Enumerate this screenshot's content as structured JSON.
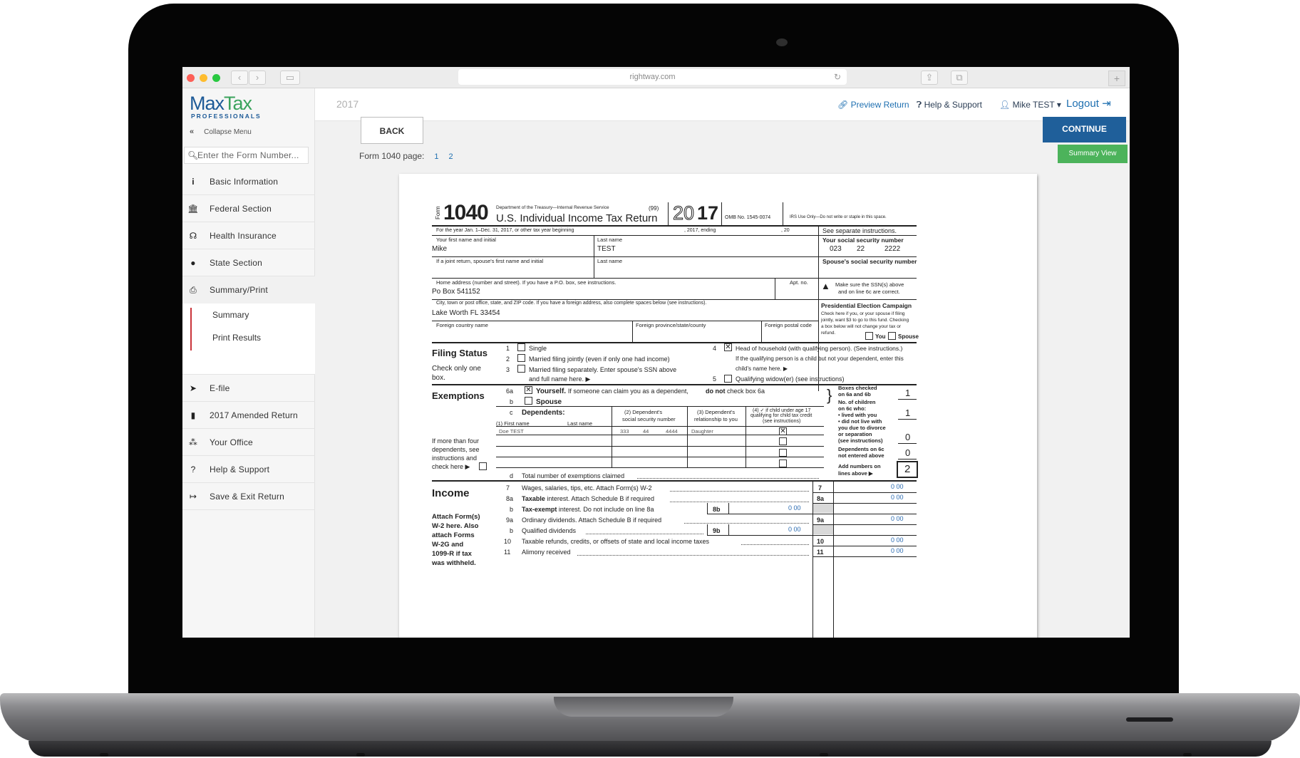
{
  "browser": {
    "url": "rightway.com"
  },
  "brand": {
    "logo_max": "Max",
    "logo_tax": "Tax",
    "logo_sub": "PROFESSIONALS",
    "colors": {
      "primary": "#1d5a97",
      "green": "#3aa35c",
      "accent_red": "#c9343a",
      "continue_blue": "#1f5f9a",
      "summary_green": "#4cb35b"
    }
  },
  "sidebar": {
    "collapse": "Collapse Menu",
    "search_placeholder": "Enter the Form Number...",
    "items": [
      {
        "label": "Basic Information",
        "icon": "info-icon"
      },
      {
        "label": "Federal Section",
        "icon": "bank-icon"
      },
      {
        "label": "Health Insurance",
        "icon": "stethoscope-icon"
      },
      {
        "label": "State Section",
        "icon": "map-pin-icon"
      },
      {
        "label": "Summary/Print",
        "icon": "printer-icon"
      },
      {
        "label": "E-file",
        "icon": "send-icon"
      },
      {
        "label": "2017 Amended Return",
        "icon": "document-icon"
      },
      {
        "label": "Your Office",
        "icon": "cubes-icon"
      },
      {
        "label": "Help & Support",
        "icon": "question-icon"
      },
      {
        "label": "Save & Exit Return",
        "icon": "sign-out-icon"
      }
    ],
    "sub_items": [
      "Summary",
      "Print Results"
    ]
  },
  "topbar": {
    "year": "2017",
    "preview": "Preview Return",
    "help": "Help & Support",
    "user": "Mike TEST ▾",
    "logout": "Logout"
  },
  "content": {
    "back": "BACK",
    "continue": "CONTINUE",
    "form_page_label": "Form 1040 page:",
    "pages": [
      "1",
      "2"
    ],
    "summary_view": "Summary View"
  },
  "form": {
    "form_word": "Form",
    "number": "1040",
    "dept": "Department of the Treasury—Internal Revenue Service",
    "code": "(99)",
    "title": "U.S. Individual Income Tax Return",
    "year_outline": "20",
    "year_bold": "17",
    "omb": "OMB No. 1545-0074",
    "irs_use": "IRS Use Only—Do not write or staple in this space.",
    "period": "For the year Jan. 1–Dec. 31, 2017, or other tax year beginning",
    "ending": ", 2017, ending",
    "twenty": ", 20",
    "see_sep": "See separate instructions.",
    "first_name_label": "Your first name and initial",
    "first_name": "Mike",
    "last_name_label": "Last name",
    "last_name": "TEST",
    "ssn_label": "Your social security number",
    "ssn": [
      "023",
      "22",
      "2222"
    ],
    "spouse_name_label": "If a joint return, spouse's first name and initial",
    "spouse_last_label": "Last name",
    "spouse_ssn_label": "Spouse's social security number",
    "address_label": "Home address (number and street). If you have a P.O. box, see instructions.",
    "address": "Po Box 541152",
    "apt_label": "Apt. no.",
    "ssn_note": [
      "Make sure the SSN(s) above",
      "and on line 6c are correct."
    ],
    "city_label": "City, town or post office, state, and ZIP code. If you have a foreign address, also complete spaces below (see instructions).",
    "city": "Lake Worth FL 33454",
    "pec_title": "Presidential Election Campaign",
    "pec_text": [
      "Check here if you, or your spouse if filing",
      "jointly, want $3 to go to this fund. Checking",
      "a box below will not change your tax or",
      "refund."
    ],
    "pec_you": "You",
    "pec_spouse": "Spouse",
    "foreign_country": "Foreign country name",
    "foreign_province": "Foreign province/state/county",
    "foreign_postal": "Foreign postal code",
    "filing_status_title": "Filing Status",
    "filing_check_note": [
      "Check only one",
      "box."
    ],
    "fs1": "Single",
    "fs2": "Married filing jointly (even if only one had income)",
    "fs3": "Married filing separately. Enter spouse's SSN above",
    "fs3b": "and full name here.  ▶",
    "fs4": "Head of household (with qualifying person). (See instructions.)",
    "fs4b": "If the qualifying person is a child but not your dependent, enter this",
    "fs4c": "child's name here.  ▶",
    "fs5": "Qualifying widow(er) (see instructions)",
    "exemptions_title": "Exemptions",
    "ex6a_bold": "Yourself.",
    "ex6a_rest": "If someone can claim you as a dependent,",
    "ex6a_donot": "do not",
    "ex6a_end": "check box 6a",
    "ex6b": "Spouse",
    "dependents": "Dependents:",
    "dep_col1": "(1) First name",
    "dep_col1b": "Last name",
    "dep_col2": [
      "(2) Dependent's",
      "social security number"
    ],
    "dep_col3": [
      "(3) Dependent's",
      "relationship to you"
    ],
    "dep_col4": [
      "(4) ✓ if child under age 17",
      "qualifying for child tax credit",
      "(see instructions)"
    ],
    "dep1_name": "Doe TEST",
    "dep1_ssn": [
      "333",
      "44",
      "4444"
    ],
    "dep1_rel": "Daughter",
    "more_than_four": [
      "If more than four",
      "dependents, see",
      "instructions and",
      "check here  ▶"
    ],
    "total_exemptions": "Total number of exemptions claimed",
    "boxes_checked": [
      "Boxes checked",
      "on 6a and 6b"
    ],
    "boxes_val": "1",
    "children_lived": [
      "No. of children",
      "on 6c who:",
      "• lived with you",
      "• did not live with",
      "you due to divorce",
      "or separation",
      "(see instructions)"
    ],
    "children_val1": "1",
    "children_val2": "0",
    "dep_not_entered": [
      "Dependents on 6c",
      "not entered above"
    ],
    "dep_not_val": "0",
    "add_numbers": [
      "Add numbers on",
      "lines above ▶"
    ],
    "add_val": "2",
    "income_title": "Income",
    "income_note": [
      "Attach Form(s)",
      "W-2 here. Also",
      "attach Forms",
      "W-2G and",
      "1099-R if tax",
      "was withheld."
    ],
    "lines": [
      {
        "num": "7",
        "text": "Wages, salaries, tips, etc. Attach Form(s) W-2",
        "box": "7",
        "val": "0  00"
      },
      {
        "num": "8a",
        "bold": "Taxable",
        "text": " interest. Attach Schedule B if required",
        "box": "8a",
        "val": "0  00"
      },
      {
        "num": "b",
        "bold": "Tax-exempt",
        "text": " interest.  Do not include on line 8a",
        "inner": "8b",
        "inner_val": "0  00"
      },
      {
        "num": "9a",
        "text": "Ordinary dividends. Attach Schedule B if required",
        "box": "9a",
        "val": "0  00"
      },
      {
        "num": "b",
        "text": "Qualified dividends",
        "inner": "9b",
        "inner_val": "0  00"
      },
      {
        "num": "10",
        "text": "Taxable refunds, credits, or offsets of state and local income taxes",
        "box": "10",
        "val": "0  00"
      },
      {
        "num": "11",
        "text": "Alimony received",
        "box": "11",
        "val": "0  00"
      }
    ]
  }
}
